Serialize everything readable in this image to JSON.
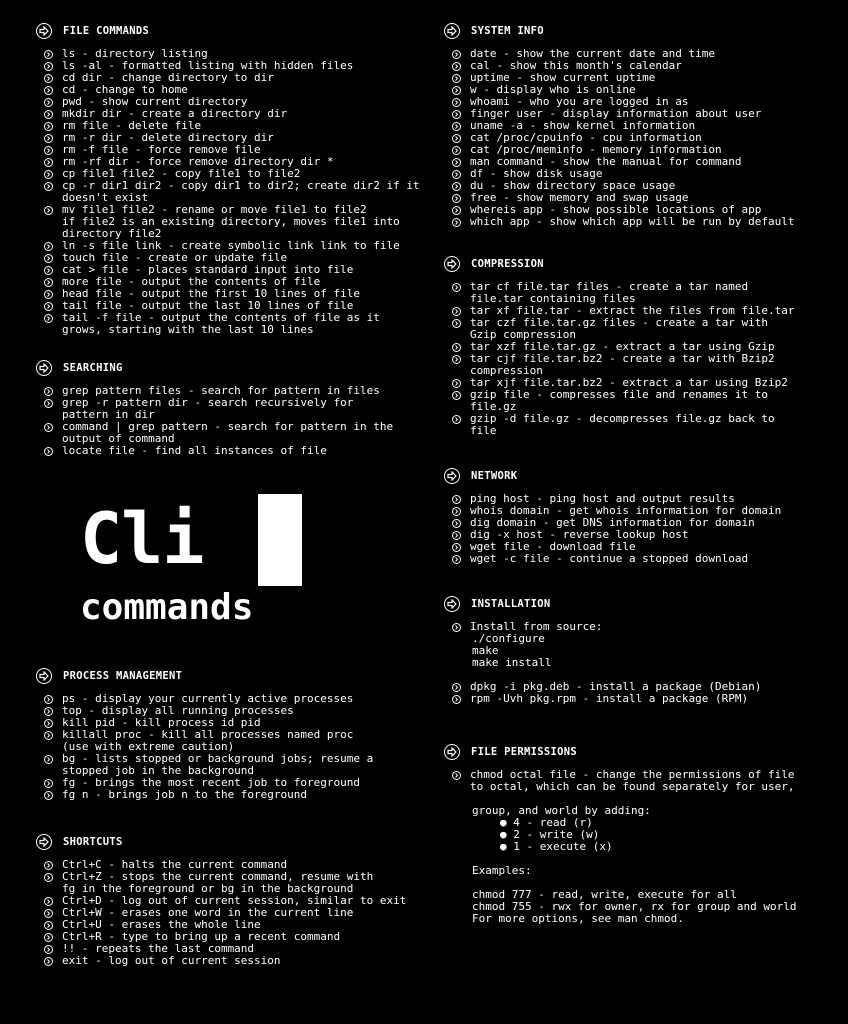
{
  "file_commands": {
    "title": "FILE COMMANDS",
    "items": [
      "ls - directory listing",
      "ls -al - formatted listing with hidden files",
      "cd dir - change directory to dir",
      "cd - change to home",
      "pwd - show current directory",
      "mkdir dir - create a directory dir",
      "rm file - delete file",
      "rm -r dir - delete directory dir",
      "rm -f file - force remove file",
      "rm -rf dir - force remove directory dir *",
      "cp file1 file2 - copy file1 to file2",
      "cp -r dir1 dir2 - copy dir1 to dir2; create dir2 if it\ndoesn't exist",
      "mv file1 file2 - rename or move file1 to file2\nif file2 is an existing directory, moves file1 into\ndirectory file2",
      "ln -s file link - create symbolic link link to file",
      "touch file - create or update file",
      "cat > file - places standard input into file",
      "more file - output the contents of file",
      "head file - output the first 10 lines of file",
      "tail file - output the last 10 lines of file",
      "tail -f file - output the contents of file as it\ngrows, starting with the last 10 lines"
    ]
  },
  "searching": {
    "title": "SEARCHING",
    "items": [
      "grep pattern files - search for pattern in files",
      "grep -r pattern dir - search recursively for\npattern in dir",
      "command | grep pattern - search for pattern in the\noutput of command",
      "locate file - find all instances of file"
    ]
  },
  "logo": {
    "main": "Cli",
    "sub": "commands"
  },
  "process_management": {
    "title": "PROCESS MANAGEMENT",
    "items": [
      "ps - display your currently active processes",
      "top - display all running processes",
      "kill pid - kill process id pid",
      "killall proc - kill all processes named proc\n(use with extreme caution)",
      "bg - lists stopped or background jobs; resume a\nstopped job in the background",
      "fg - brings the most recent job to foreground",
      "fg n - brings job n to the foreground"
    ]
  },
  "shortcuts": {
    "title": "SHORTCUTS",
    "items": [
      "Ctrl+C - halts the current command",
      "Ctrl+Z - stops the current command, resume with\nfg in the foreground or bg in the background",
      "Ctrl+D - log out of current session, similar to exit",
      "Ctrl+W - erases one word in the current line",
      "Ctrl+U - erases the whole line",
      "Ctrl+R - type to bring up a recent command",
      "!! - repeats the last command",
      "exit - log out of current session"
    ]
  },
  "system_info": {
    "title": "SYSTEM INFO",
    "items": [
      "date - show the current date and time",
      "cal - show this month's calendar",
      "uptime - show current uptime",
      "w - display who is online",
      "whoami - who you are logged in as",
      "finger user - display information about user",
      "uname -a - show kernel information",
      "cat /proc/cpuinfo - cpu information",
      "cat /proc/meminfo - memory information",
      "man command - show the manual for command",
      "df - show disk usage",
      "du - show directory space usage",
      "free - show memory and swap usage",
      "whereis app - show possible locations of app",
      "which app - show which app will be run by default"
    ]
  },
  "compression": {
    "title": "COMPRESSION",
    "items": [
      "tar cf file.tar files - create a tar named\nfile.tar containing files",
      "tar xf file.tar - extract the files from file.tar",
      "tar czf file.tar.gz files - create a tar with\nGzip compression",
      "tar xzf file.tar.gz - extract a tar using Gzip",
      "tar cjf file.tar.bz2 - create a tar with Bzip2\ncompression",
      "tar xjf file.tar.bz2 - extract a tar using Bzip2",
      "gzip file - compresses file and renames it to\nfile.gz",
      "gzip -d file.gz - decompresses file.gz back to\nfile"
    ]
  },
  "network": {
    "title": "NETWORK",
    "items": [
      "ping host - ping host and output results",
      "whois domain - get whois information for domain",
      "dig domain - get DNS information for domain",
      "dig -x host - reverse lookup host",
      "wget file - download file",
      "wget -c file - continue a stopped download"
    ]
  },
  "installation": {
    "title": "INSTALLATION",
    "install_from_source": "Install from source:",
    "steps": [
      "./configure",
      "make",
      "make install"
    ],
    "items": [
      "dpkg -i pkg.deb - install a package (Debian)",
      "rpm -Uvh pkg.rpm - install a package (RPM)"
    ]
  },
  "file_permissions": {
    "title": "FILE PERMISSIONS",
    "intro": "chmod octal file - change the permissions of file\nto octal, which can be found separately for user,",
    "adding": "group, and world by adding:",
    "perms": [
      "4 - read (r)",
      "2 - write (w)",
      "1 - execute (x)"
    ],
    "examples_label": "Examples:",
    "examples": [
      "chmod 777 - read, write, execute for all",
      "chmod 755 - rwx for owner, rx for group and world",
      "For more options, see man chmod."
    ]
  }
}
